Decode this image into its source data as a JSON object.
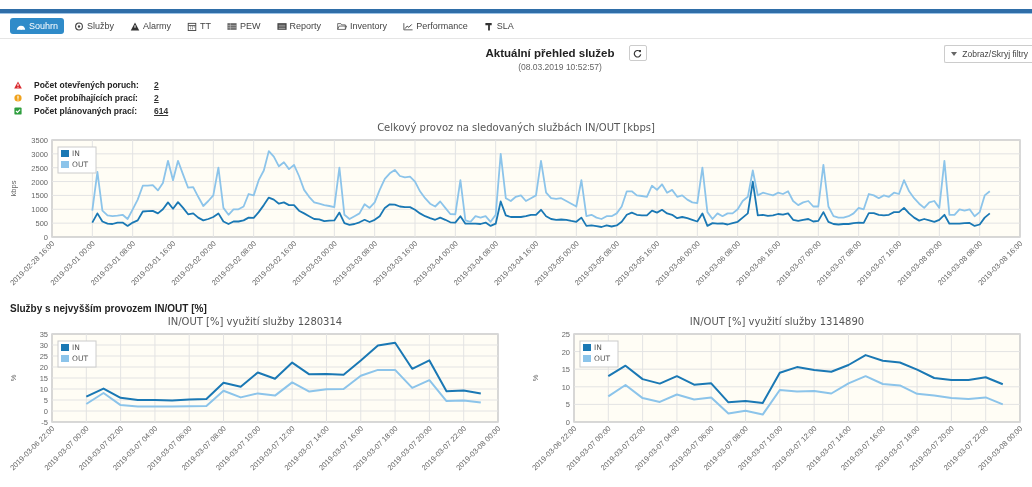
{
  "nav": {
    "tabs": [
      {
        "label": "Souhrn",
        "selected": true
      },
      {
        "label": "Služby",
        "selected": false
      },
      {
        "label": "Alarmy",
        "selected": false
      },
      {
        "label": "TT",
        "selected": false
      },
      {
        "label": "PEW",
        "selected": false
      },
      {
        "label": "Reporty",
        "selected": false
      },
      {
        "label": "Inventory",
        "selected": false
      },
      {
        "label": "Performance",
        "selected": false
      },
      {
        "label": "SLA",
        "selected": false
      }
    ]
  },
  "header": {
    "title": "Aktuální přehled služeb",
    "timestamp": "(08.03.2019 10:52:57)",
    "filter_button": "Zobraz/Skryj filtry"
  },
  "stats": [
    {
      "kind": "error",
      "label": "Počet otevřených poruch:",
      "value": "2"
    },
    {
      "kind": "warning",
      "label": "Počet probíhajících prací:",
      "value": "2"
    },
    {
      "kind": "success",
      "label": "Počet plánovaných prací:",
      "value": "614"
    }
  ],
  "traffic_chart": {
    "chart_data": {
      "type": "line",
      "title": "Celkový provoz na sledovaných službách IN/OUT [kbps]",
      "ylabel": "kbps",
      "grid": true,
      "legend": "top-left",
      "ylim": [
        0,
        3500
      ],
      "yticks": [
        0,
        500,
        1000,
        1500,
        2000,
        2500,
        3000,
        3500
      ],
      "categories": [
        "2019-02-28 16:00",
        null,
        null,
        null,
        null,
        null,
        null,
        null,
        "2019-03-01 00:00",
        null,
        null,
        null,
        null,
        null,
        null,
        null,
        "2019-03-01 08:00",
        null,
        null,
        null,
        null,
        null,
        null,
        null,
        "2019-03-01 16:00",
        null,
        null,
        null,
        null,
        null,
        null,
        null,
        "2019-03-02 00:00",
        null,
        null,
        null,
        null,
        null,
        null,
        null,
        "2019-03-02 08:00",
        null,
        null,
        null,
        null,
        null,
        null,
        null,
        "2019-03-02 16:00",
        null,
        null,
        null,
        null,
        null,
        null,
        null,
        "2019-03-03 00:00",
        null,
        null,
        null,
        null,
        null,
        null,
        null,
        "2019-03-03 08:00",
        null,
        null,
        null,
        null,
        null,
        null,
        null,
        "2019-03-03 16:00",
        null,
        null,
        null,
        null,
        null,
        null,
        null,
        "2019-03-04 00:00",
        null,
        null,
        null,
        null,
        null,
        null,
        null,
        "2019-03-04 08:00",
        null,
        null,
        null,
        null,
        null,
        null,
        null,
        "2019-03-04 16:00",
        null,
        null,
        null,
        null,
        null,
        null,
        null,
        "2019-03-05 00:00",
        null,
        null,
        null,
        null,
        null,
        null,
        null,
        "2019-03-05 08:00",
        null,
        null,
        null,
        null,
        null,
        null,
        null,
        "2019-03-05 16:00",
        null,
        null,
        null,
        null,
        null,
        null,
        null,
        "2019-03-06 00:00",
        null,
        null,
        null,
        null,
        null,
        null,
        null,
        "2019-03-06 08:00",
        null,
        null,
        null,
        null,
        null,
        null,
        null,
        "2019-03-06 16:00",
        null,
        null,
        null,
        null,
        null,
        null,
        null,
        "2019-03-07 00:00",
        null,
        null,
        null,
        null,
        null,
        null,
        null,
        "2019-03-07 08:00",
        null,
        null,
        null,
        null,
        null,
        null,
        null,
        "2019-03-07 16:00",
        null,
        null,
        null,
        null,
        null,
        null,
        null,
        "2019-03-08 00:00",
        null,
        null,
        null,
        null,
        null,
        null,
        null,
        "2019-03-08 08:00",
        null,
        null,
        null,
        null,
        null,
        null,
        null,
        "2019-03-08 16:00"
      ],
      "series": [
        {
          "name": "IN",
          "color": "#1a78b4",
          "values": [
            null,
            null,
            null,
            null,
            null,
            null,
            null,
            null,
            520,
            850,
            560,
            480,
            470,
            520,
            520,
            400,
            520,
            600,
            920,
            930,
            940,
            850,
            1000,
            1250,
            1020,
            1260,
            1050,
            820,
            850,
            700,
            600,
            650,
            720,
            850,
            560,
            470,
            560,
            560,
            600,
            700,
            690,
            900,
            1150,
            1420,
            1350,
            1200,
            1250,
            1150,
            1150,
            950,
            850,
            750,
            650,
            640,
            570,
            590,
            600,
            880,
            500,
            440,
            470,
            530,
            620,
            540,
            620,
            750,
            1050,
            1180,
            1170,
            1100,
            1080,
            1080,
            980,
            850,
            750,
            680,
            620,
            700,
            620,
            530,
            520,
            750,
            480,
            480,
            480,
            470,
            520,
            400,
            480,
            1280,
            780,
            720,
            720,
            720,
            750,
            800,
            800,
            980,
            750,
            650,
            620,
            630,
            620,
            580,
            550,
            700,
            400,
            420,
            390,
            360,
            420,
            380,
            420,
            550,
            800,
            880,
            800,
            780,
            780,
            950,
            880,
            980,
            850,
            800,
            680,
            720,
            680,
            620,
            560,
            850,
            400,
            500,
            480,
            490,
            450,
            500,
            550,
            700,
            850,
            2000,
            780,
            800,
            760,
            780,
            830,
            810,
            850,
            620,
            580,
            620,
            650,
            560,
            580,
            900,
            550,
            470,
            450,
            470,
            470,
            500,
            520,
            510,
            860,
            860,
            800,
            780,
            800,
            900,
            900,
            1050,
            850,
            700,
            590,
            650,
            600,
            550,
            620,
            800,
            480,
            480,
            480,
            500,
            510,
            400,
            450,
            700,
            850,
            null,
            null,
            null,
            null,
            null,
            null
          ]
        },
        {
          "name": "OUT",
          "color": "#8cc4ea",
          "values": [
            null,
            null,
            null,
            null,
            null,
            null,
            null,
            null,
            950,
            2350,
            950,
            780,
            750,
            770,
            800,
            650,
            1000,
            1350,
            1850,
            1850,
            1870,
            1680,
            1950,
            2750,
            2050,
            2750,
            2250,
            1780,
            1800,
            1450,
            1120,
            1300,
            1500,
            2500,
            1050,
            800,
            1000,
            1000,
            1100,
            1550,
            1500,
            2050,
            2400,
            3100,
            2900,
            2550,
            2700,
            2450,
            2600,
            2200,
            1700,
            1450,
            1250,
            1200,
            1150,
            1120,
            1080,
            2500,
            800,
            650,
            750,
            850,
            1180,
            1050,
            1250,
            1700,
            2100,
            2300,
            2420,
            2200,
            2150,
            2180,
            2000,
            1650,
            1400,
            1200,
            1100,
            1280,
            1050,
            830,
            820,
            2050,
            600,
            550,
            750,
            700,
            750,
            550,
            800,
            3000,
            1400,
            1300,
            1450,
            1500,
            1300,
            1400,
            1500,
            2750,
            1600,
            1400,
            1380,
            1400,
            1300,
            1200,
            1100,
            2050,
            750,
            800,
            700,
            650,
            750,
            750,
            850,
            1100,
            1650,
            1650,
            1500,
            1480,
            1450,
            1850,
            1700,
            1900,
            1600,
            1700,
            1450,
            1500,
            1350,
            1250,
            1220,
            2500,
            900,
            650,
            850,
            750,
            850,
            850,
            1000,
            1300,
            1450,
            2400,
            1500,
            1600,
            1550,
            1500,
            1600,
            1550,
            1650,
            1300,
            1150,
            1250,
            1300,
            1100,
            1100,
            2600,
            1100,
            750,
            700,
            700,
            750,
            850,
            1050,
            1000,
            1550,
            1500,
            1400,
            1500,
            1450,
            1600,
            1550,
            2050,
            1650,
            1400,
            1200,
            1050,
            1250,
            1300,
            1050,
            2750,
            800,
            800,
            1000,
            950,
            1000,
            750,
            900,
            1500,
            1650,
            null,
            null,
            null,
            null,
            null,
            null
          ]
        }
      ]
    }
  },
  "top_services": {
    "heading": "Služby s nejvyšším provozem IN/OUT [%]",
    "charts": [
      {
        "chart_data": {
          "type": "line",
          "title": "IN/OUT [%] využití služby 1280314",
          "ylabel": "%",
          "grid": true,
          "legend": "top-left",
          "ylim": [
            -5,
            35
          ],
          "yticks": [
            -5,
            0,
            5,
            10,
            15,
            20,
            25,
            30,
            35
          ],
          "categories": [
            "2019-03-06 22:00",
            null,
            "2019-03-07 00:00",
            null,
            "2019-03-07 02:00",
            null,
            "2019-03-07 04:00",
            null,
            "2019-03-07 06:00",
            null,
            "2019-03-07 08:00",
            null,
            "2019-03-07 10:00",
            null,
            "2019-03-07 12:00",
            null,
            "2019-03-07 14:00",
            null,
            "2019-03-07 16:00",
            null,
            "2019-03-07 18:00",
            null,
            "2019-03-07 20:00",
            null,
            "2019-03-07 22:00",
            null,
            "2019-03-08 00:00"
          ],
          "series": [
            {
              "name": "IN",
              "color": "#1a78b4",
              "values": [
                null,
                null,
                6.5,
                10.2,
                6,
                5,
                5,
                4.8,
                5.2,
                5.5,
                12.8,
                11,
                17.5,
                14.7,
                22,
                16.7,
                16.8,
                16.5,
                23,
                29.8,
                31,
                19.2,
                23,
                9,
                9.3,
                8,
                null
              ]
            },
            {
              "name": "OUT",
              "color": "#8cc4ea",
              "values": [
                null,
                null,
                3.2,
                8.2,
                2.7,
                2,
                2,
                2,
                2.2,
                2.3,
                9.2,
                6.2,
                8,
                7,
                13,
                8.8,
                9.9,
                10,
                16,
                18.7,
                18.7,
                10.5,
                14,
                4.5,
                4.8,
                3.8,
                null
              ]
            }
          ]
        }
      },
      {
        "chart_data": {
          "type": "line",
          "title": "IN/OUT [%] využití služby 1314890",
          "ylabel": "%",
          "grid": true,
          "legend": "top-left",
          "ylim": [
            0,
            25
          ],
          "yticks": [
            0,
            5,
            10,
            15,
            20,
            25
          ],
          "categories": [
            "2019-03-06 22:00",
            null,
            "2019-03-07 00:00",
            null,
            "2019-03-07 02:00",
            null,
            "2019-03-07 04:00",
            null,
            "2019-03-07 06:00",
            null,
            "2019-03-07 08:00",
            null,
            "2019-03-07 10:00",
            null,
            "2019-03-07 12:00",
            null,
            "2019-03-07 14:00",
            null,
            "2019-03-07 16:00",
            null,
            "2019-03-07 18:00",
            null,
            "2019-03-07 20:00",
            null,
            "2019-03-07 22:00",
            null,
            "2019-03-08 00:00"
          ],
          "series": [
            {
              "name": "IN",
              "color": "#1a78b4",
              "values": [
                null,
                null,
                13,
                16,
                12.2,
                10.9,
                13,
                10.6,
                11,
                5.6,
                6,
                5.4,
                14,
                15.6,
                14.8,
                14.3,
                16.2,
                19,
                17.4,
                16.9,
                14.9,
                12.5,
                11.9,
                11.9,
                12.7,
                10.7,
                null
              ]
            },
            {
              "name": "OUT",
              "color": "#8cc4ea",
              "values": [
                null,
                null,
                7.3,
                10.5,
                6.8,
                5.7,
                7.8,
                6.4,
                7,
                2.4,
                3.2,
                2.1,
                9.1,
                8.7,
                8.8,
                8.1,
                11,
                13,
                10.8,
                10.4,
                8,
                7.5,
                6.8,
                6.5,
                7,
                5,
                null
              ]
            }
          ]
        }
      }
    ]
  }
}
